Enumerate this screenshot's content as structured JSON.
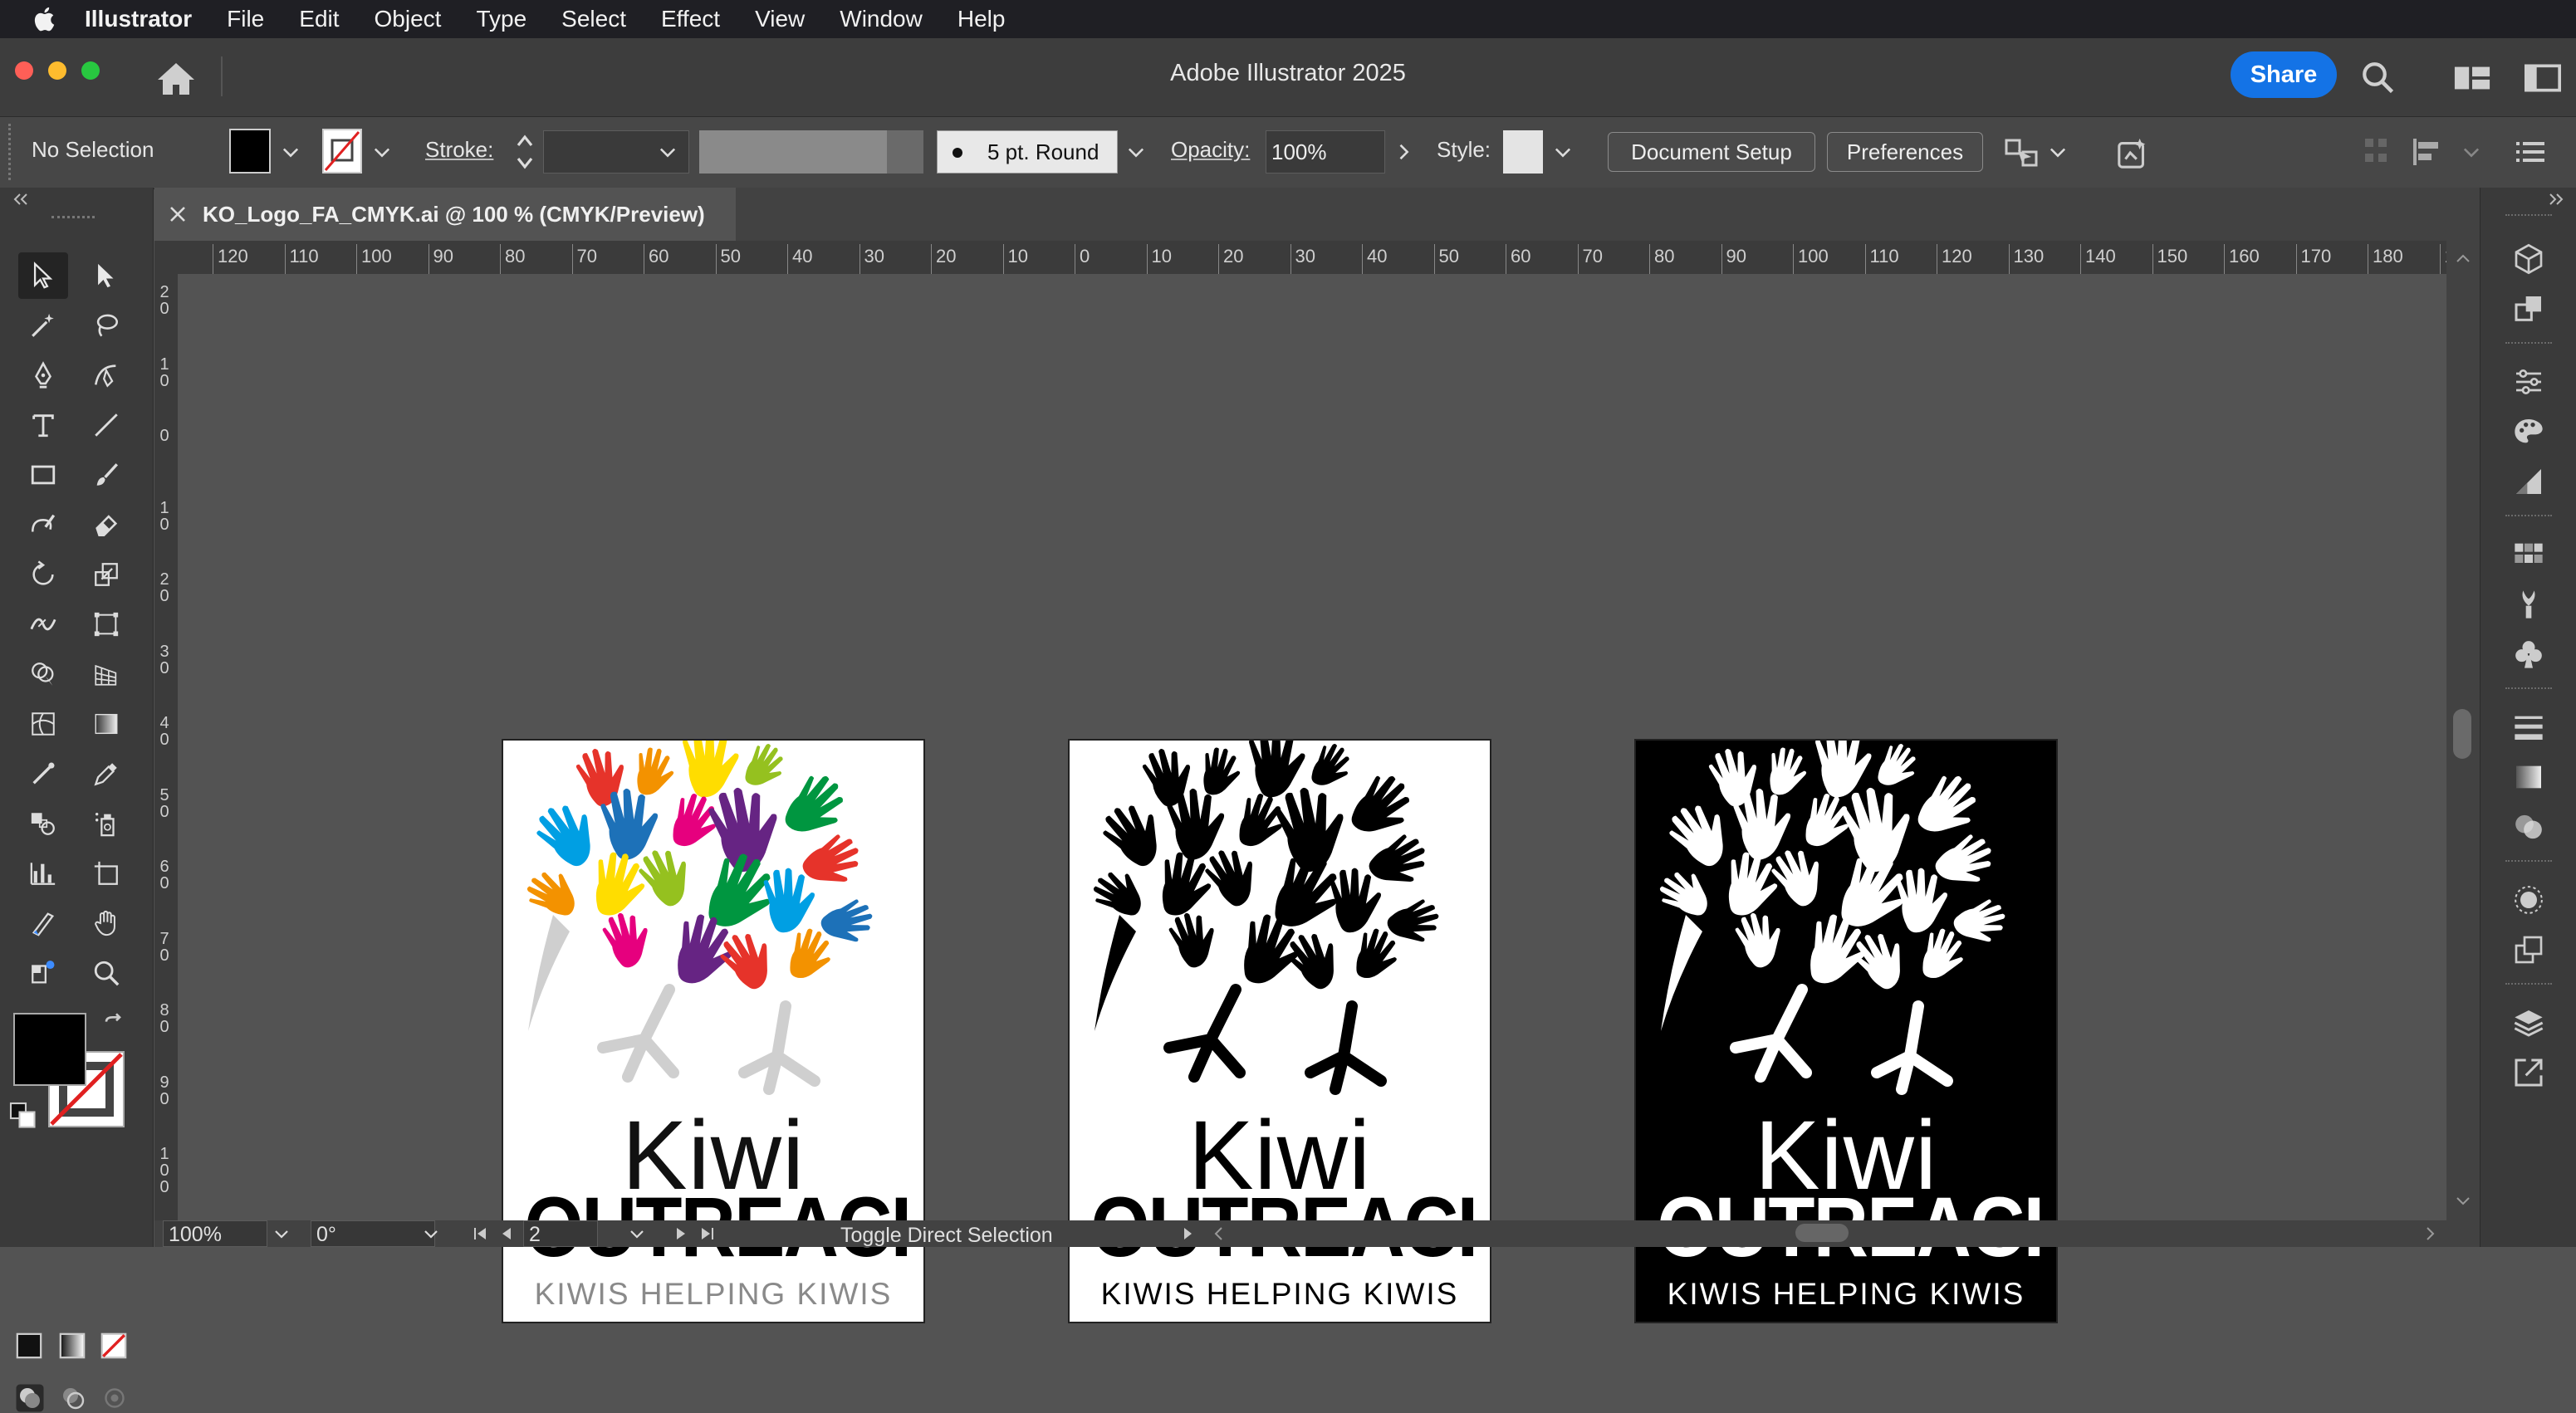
{
  "menubar": {
    "app": "Illustrator",
    "items": [
      "File",
      "Edit",
      "Object",
      "Type",
      "Select",
      "Effect",
      "View",
      "Window",
      "Help"
    ]
  },
  "window": {
    "title": "Adobe Illustrator 2025",
    "share": "Share"
  },
  "controlbar": {
    "selection": "No Selection",
    "stroke_label": "Stroke:",
    "brush": "5 pt. Round",
    "opacity_label": "Opacity:",
    "opacity_value": "100%",
    "style_label": "Style:",
    "document_setup": "Document Setup",
    "preferences": "Preferences"
  },
  "document": {
    "tab_label": "KO_Logo_FA_CMYK.ai @ 100 % (CMYK/Preview)"
  },
  "rulers": {
    "horizontal": [
      "120",
      "110",
      "100",
      "90",
      "80",
      "70",
      "60",
      "50",
      "40",
      "30",
      "20",
      "10",
      "0",
      "10",
      "20",
      "30",
      "40",
      "50",
      "60",
      "70",
      "80",
      "90",
      "100",
      "110",
      "120",
      "130",
      "140",
      "150",
      "160",
      "170",
      "180",
      "19"
    ],
    "vertical": [
      "2\n0",
      "1\n0",
      "0",
      "1\n0",
      "2\n0",
      "3\n0",
      "4\n0",
      "5\n0",
      "6\n0",
      "7\n0",
      "8\n0",
      "9\n0",
      "1\n0\n0"
    ]
  },
  "artboards": [
    {
      "variant": "color",
      "word1": "Kiwi",
      "word2": "OUTREACH",
      "tagline": "KIWIS HELPING KIWIS"
    },
    {
      "variant": "black",
      "word1": "Kiwi",
      "word2": "OUTREACH",
      "tagline": "KIWIS HELPING KIWIS"
    },
    {
      "variant": "reversed",
      "word1": "Kiwi",
      "word2": "OUTREACH",
      "tagline": "KIWIS HELPING KIWIS"
    }
  ],
  "statusbar": {
    "zoom": "100%",
    "rotation": "0°",
    "artboard_number": "2",
    "status_text": "Toggle Direct Selection"
  },
  "colors": {
    "hand_palette": [
      "#e6332a",
      "#f39200",
      "#ffdd00",
      "#95c11f",
      "#009640",
      "#009fe3",
      "#1d71b8",
      "#e6007e",
      "#662483"
    ],
    "share_blue": "#1473e6"
  },
  "icons": [
    "apple-icon",
    "home-icon",
    "search-icon",
    "workspace-icon",
    "panel-icon",
    "selection-tool-icon",
    "direct-selection-tool-icon",
    "magic-wand-icon",
    "lasso-icon",
    "pen-icon",
    "curvature-icon",
    "type-icon",
    "line-icon",
    "rectangle-icon",
    "paintbrush-icon",
    "shaper-icon",
    "eraser-icon",
    "rotate-icon",
    "scale-icon",
    "width-icon",
    "free-transform-icon",
    "shape-builder-icon",
    "perspective-icon",
    "mesh-icon",
    "gradient-icon",
    "eyedropper-icon",
    "blend-icon",
    "symbol-sprayer-icon",
    "column-graph-icon",
    "artboard-tool-icon",
    "slice-icon",
    "hand-icon",
    "zoom-icon",
    "fill-swatch-icon",
    "stroke-swatch-icon"
  ]
}
